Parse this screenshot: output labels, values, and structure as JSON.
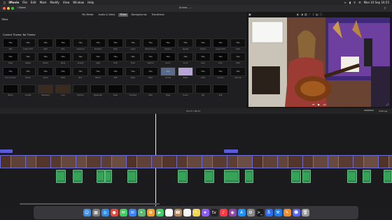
{
  "menubar": {
    "app_name": "iMovie",
    "items": [
      "File",
      "Edit",
      "Mark",
      "Modify",
      "View",
      "Window",
      "Help"
    ],
    "datetime": "Mon 10 Sep 16:55"
  },
  "toolbar": {
    "window_title": "Anima - ...",
    "share_label": "Share"
  },
  "browser": {
    "tabs": [
      "My Media",
      "Audio & Video",
      "Titles",
      "Backgrounds",
      "Transitions"
    ],
    "active_tab": "Titles",
    "titles_label": "Titles",
    "section_label": "Current Theme: No Theme",
    "rows": [
      [
        "Title",
        "Title",
        "Title",
        "Title",
        "Title",
        "Title",
        "Title",
        "Title",
        "Title",
        "Title",
        "Title",
        "Title",
        "Title",
        "Title"
      ],
      [
        "Title",
        "Title",
        "Title",
        "Title",
        "Title",
        "Title",
        "Title",
        "Title",
        "Title",
        "Title",
        "Title",
        "Title",
        "Title",
        "Title"
      ],
      [
        "Title",
        "Title",
        "Title",
        "Title",
        "Title",
        "Title",
        "Title",
        "Title",
        "Title",
        "Title",
        "Title",
        "Title",
        "Title",
        "Title"
      ],
      [
        "",
        "",
        "",
        "",
        "",
        "",
        "",
        "",
        "",
        "",
        "",
        "",
        ""
      ]
    ],
    "labels": [
      [
        "Title",
        "Lower Third",
        "Split",
        "Intro",
        "Centered",
        "Gradient",
        "Pillar",
        "Lower",
        "Performance",
        "Expand",
        "Reveal",
        "Cutout",
        "Lower Third",
        "Slide"
      ],
      [
        "Cube",
        "Ripple",
        "Stroke",
        "Swap",
        "Gravity",
        "Light",
        "Drift",
        "Push",
        "Vertical",
        "Zoom",
        "Scroll",
        "Lens",
        "Echo",
        "Strip"
      ],
      [
        "Four Corners",
        "Boxes",
        "Focus",
        "Slide",
        "Blur",
        "Bloom",
        "Soft",
        "Wipe",
        "Flash",
        "Clouds",
        "Glitter",
        "Orbit",
        "Corners",
        "Minimal"
      ],
      [
        "Blank",
        "Credits",
        "Newsreel",
        "Line",
        "Hairline",
        "Typewriter",
        "Pulse",
        "Gradient",
        "Fade",
        "Edge",
        "Frame",
        "Tap",
        "Soft"
      ]
    ]
  },
  "viewer": {
    "caption": "",
    "timecode": "",
    "settings_label": "Settings"
  },
  "timeline": {
    "timecode": "04:13 / 06:31"
  },
  "dock": {
    "apps": [
      "finder",
      "launchpad",
      "safari",
      "chrome",
      "messages",
      "mail",
      "maps",
      "photos",
      "facetime",
      "calendar",
      "contacts",
      "reminders",
      "notes",
      "imovie",
      "tv",
      "music",
      "podcasts",
      "app-store",
      "settings",
      "terminal",
      "bluetooth",
      "xcode",
      "pages",
      "discord",
      "trash"
    ]
  }
}
